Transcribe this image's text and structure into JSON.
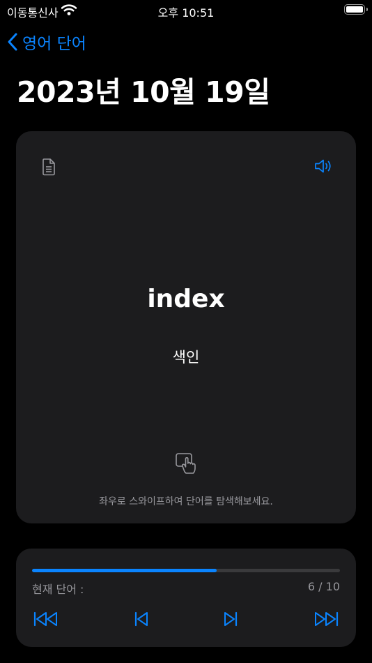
{
  "status_bar": {
    "carrier": "이동통신사",
    "time": "오후 10:51"
  },
  "nav": {
    "back_label": "영어 단어"
  },
  "page": {
    "title": "2023년 10월 19일"
  },
  "card": {
    "word": "index",
    "meaning": "색인",
    "hint": "좌우로 스와이프하여 단어를 탐색해보세요."
  },
  "progress": {
    "current_label": "현재 단어 :",
    "counter": "6 / 10",
    "current": 6,
    "total": 10
  },
  "colors": {
    "accent": "#0a84ff",
    "background": "#000000",
    "card": "#1c1c1e",
    "secondary_text": "#98989d"
  }
}
